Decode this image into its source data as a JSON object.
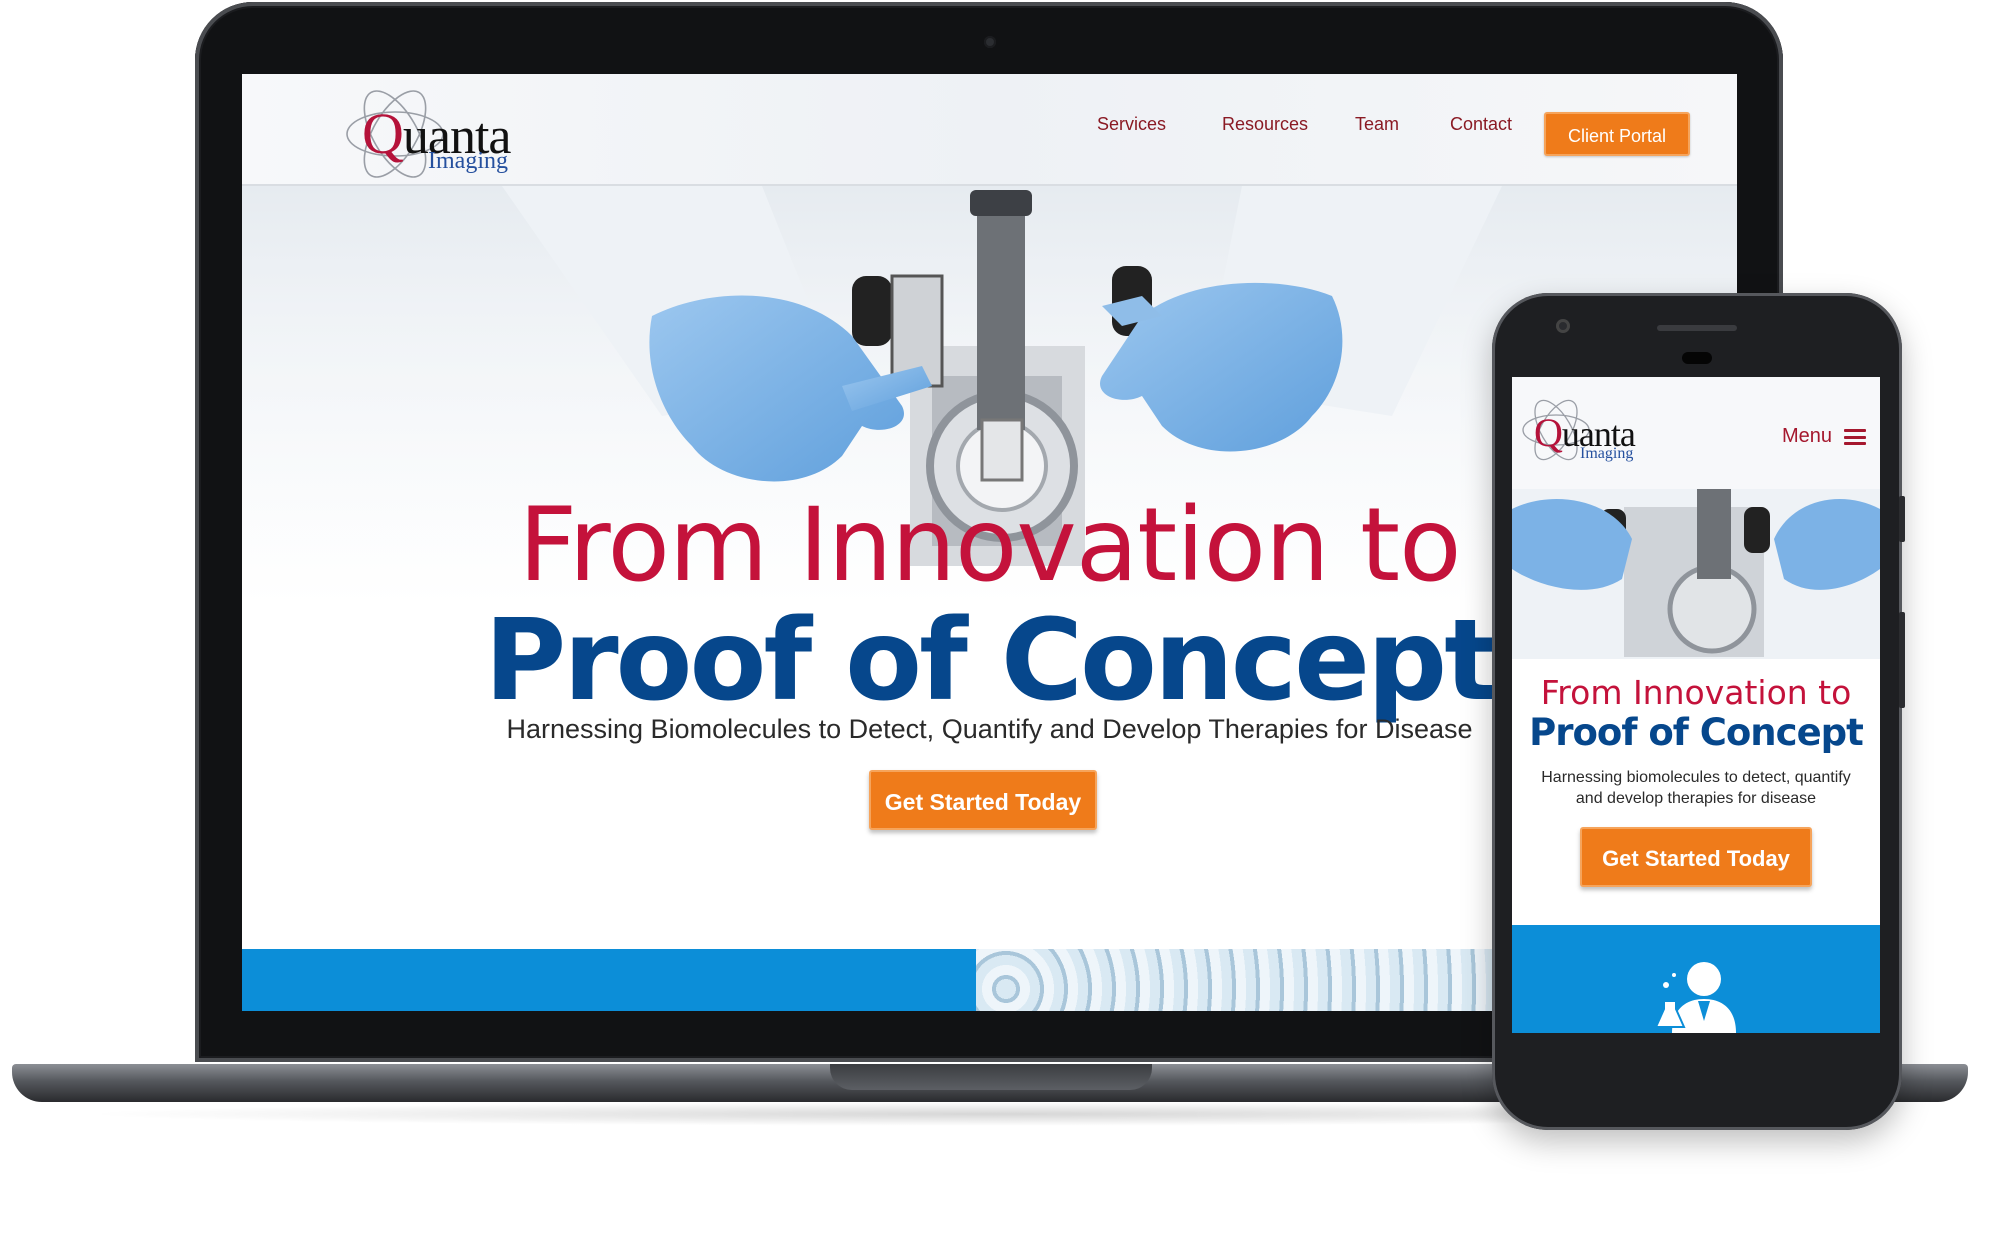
{
  "colors": {
    "brand_red": "#c4123b",
    "brand_blue": "#06478c",
    "cta_orange": "#ef7b1a",
    "band_blue": "#0c8ed8"
  },
  "desktop": {
    "logo": {
      "word_first": "Q",
      "word_rest": "uanta",
      "sub": "Imaging"
    },
    "nav": {
      "services": "Services",
      "resources": "Resources",
      "team": "Team",
      "contact": "Contact"
    },
    "portal_button": "Client Portal",
    "hero": {
      "title_line1": "From Innovation to",
      "title_line2": "Proof of Concept",
      "subtitle": "Harnessing Biomolecules to Detect, Quantify and Develop Therapies for Disease",
      "cta": "Get Started Today"
    }
  },
  "mobile": {
    "logo": {
      "word_first": "Q",
      "word_rest": "uanta",
      "sub": "Imaging"
    },
    "menu_label": "Menu",
    "menu_icon": "hamburger-icon",
    "hero": {
      "title_line1": "From Innovation to",
      "title_line2": "Proof of Concept",
      "subtitle": "Harnessing biomolecules to detect, quantify and develop therapies for disease",
      "cta": "Get Started Today"
    },
    "band_icon": "scientist-icon"
  }
}
